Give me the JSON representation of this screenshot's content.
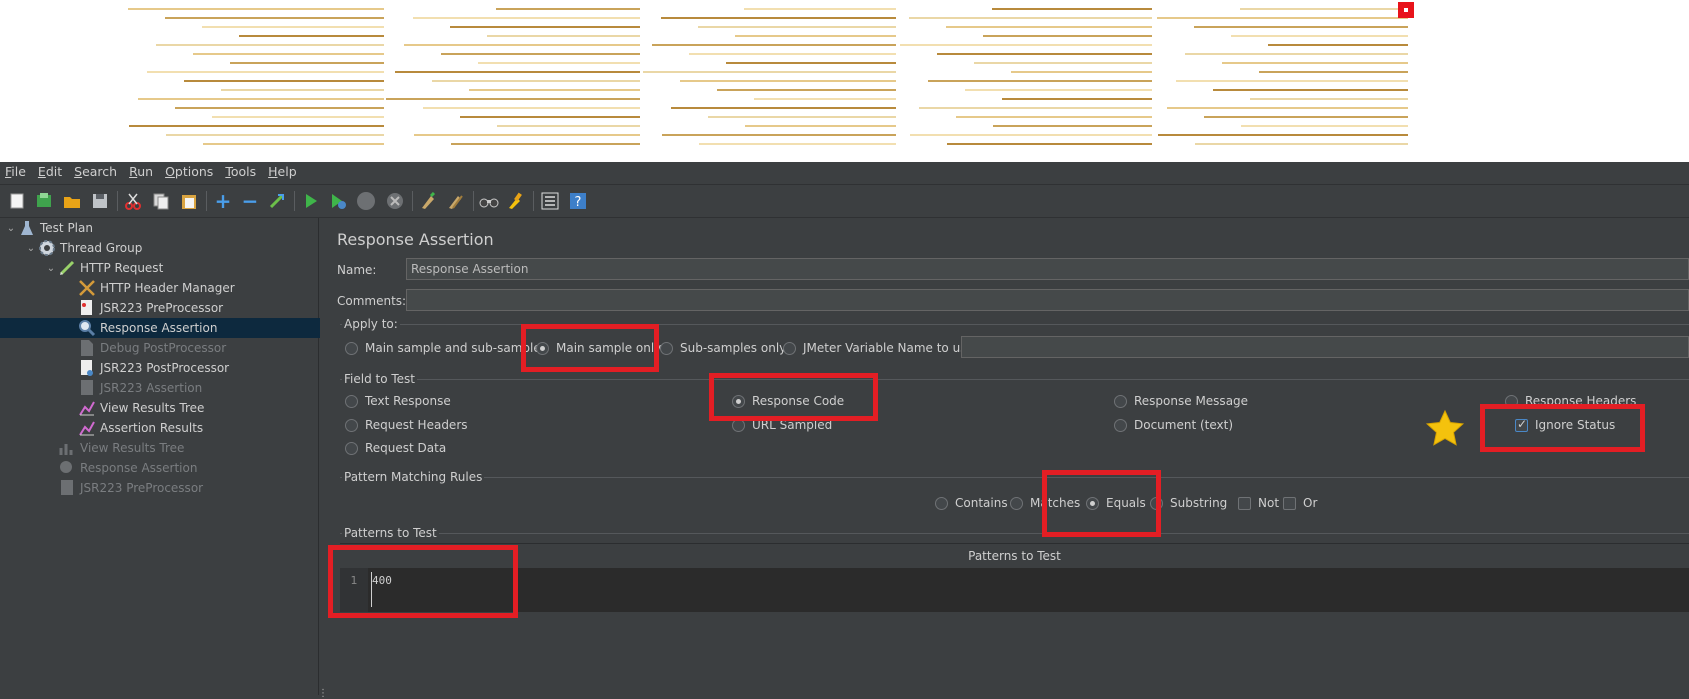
{
  "menu": [
    {
      "label": "File",
      "u": "F",
      "rest": "ile"
    },
    {
      "label": "Edit",
      "u": "E",
      "rest": "dit"
    },
    {
      "label": "Search",
      "u": "S",
      "rest": "earch"
    },
    {
      "label": "Run",
      "u": "R",
      "rest": "un"
    },
    {
      "label": "Options",
      "u": "O",
      "rest": "ptions"
    },
    {
      "label": "Tools",
      "u": "T",
      "rest": "ools"
    },
    {
      "label": "Help",
      "u": "H",
      "rest": "elp"
    }
  ],
  "toolbar_icons": [
    "new-icon",
    "templates-icon",
    "open-icon",
    "save-icon",
    "cut-icon",
    "copy-icon",
    "paste-icon",
    "expand-icon",
    "collapse-icon",
    "toggle-icon",
    "start-icon",
    "start-no-pause-icon",
    "stop-icon",
    "shutdown-icon",
    "clear-icon",
    "clear-all-icon",
    "search-icon",
    "reset-search-icon",
    "function-helper-icon",
    "help-icon"
  ],
  "tree": [
    {
      "label": "Test Plan",
      "icon": "test-plan-icon",
      "disabled": false,
      "selected": false
    },
    {
      "label": "Thread Group",
      "icon": "thread-group-icon",
      "disabled": false,
      "selected": false
    },
    {
      "label": "HTTP Request",
      "icon": "http-request-icon",
      "disabled": false,
      "selected": false
    },
    {
      "label": "HTTP Header Manager",
      "icon": "header-manager-icon",
      "disabled": false,
      "selected": false
    },
    {
      "label": "JSR223 PreProcessor",
      "icon": "preprocessor-icon",
      "disabled": false,
      "selected": false
    },
    {
      "label": "Response Assertion",
      "icon": "assertion-icon",
      "disabled": false,
      "selected": true
    },
    {
      "label": "Debug PostProcessor",
      "icon": "postprocessor-icon",
      "disabled": true,
      "selected": false
    },
    {
      "label": "JSR223 PostProcessor",
      "icon": "postprocessor-icon",
      "disabled": false,
      "selected": false
    },
    {
      "label": "JSR223 Assertion",
      "icon": "assertion-icon",
      "disabled": true,
      "selected": false
    },
    {
      "label": "View Results Tree",
      "icon": "listener-icon",
      "disabled": false,
      "selected": false
    },
    {
      "label": "Assertion Results",
      "icon": "listener-icon",
      "disabled": false,
      "selected": false
    },
    {
      "label": "View Results Tree",
      "icon": "listener-icon",
      "disabled": true,
      "selected": false
    },
    {
      "label": "Response Assertion",
      "icon": "assertion-icon",
      "disabled": true,
      "selected": false
    },
    {
      "label": "JSR223 PreProcessor",
      "icon": "preprocessor-icon",
      "disabled": true,
      "selected": false
    }
  ],
  "panel": {
    "title": "Response Assertion",
    "name_label": "Name:",
    "name_value": "Response Assertion",
    "comments_label": "Comments:",
    "comments_value": "",
    "apply_to": {
      "title": "Apply to:",
      "main_and_sub": "Main sample and sub-samples",
      "main_only": "Main sample only",
      "sub_only": "Sub-samples only",
      "jmeter_var": "JMeter Variable Name to use",
      "selected": "main_only"
    },
    "field_to_test": {
      "title": "Field to Test",
      "text_response": "Text Response",
      "response_code": "Response Code",
      "response_message": "Response Message",
      "response_headers": "Response Headers",
      "request_headers": "Request Headers",
      "url_sampled": "URL Sampled",
      "document": "Document (text)",
      "ignore_status": "Ignore Status",
      "request_data": "Request Data",
      "selected": "response_code",
      "ignore_status_checked": true
    },
    "pattern_rules": {
      "title": "Pattern Matching Rules",
      "contains": "Contains",
      "matches": "Matches",
      "equals": "Equals",
      "substring": "Substring",
      "not": "Not",
      "or": "Or",
      "selected": "equals"
    },
    "patterns": {
      "title": "Patterns to Test",
      "column": "Patterns to Test",
      "line_number": "1",
      "value": "400"
    }
  },
  "colors": {
    "annotation": "#e31e24",
    "selection": "#0d293e",
    "star": "#f4c20d"
  }
}
